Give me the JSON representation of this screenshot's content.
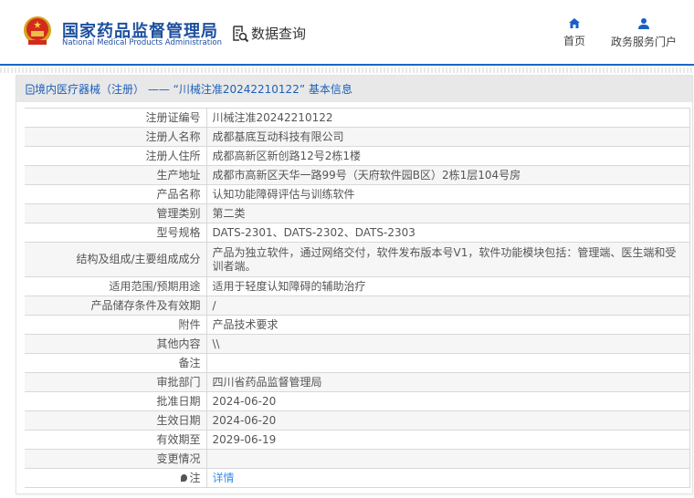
{
  "header": {
    "brand_cn": "国家药品监督管理局",
    "brand_en": "National Medical Products Administration",
    "data_query": "数据查询",
    "nav": [
      {
        "label": "首页",
        "icon": "home-icon"
      },
      {
        "label": "政务服务门户",
        "icon": "user-icon"
      }
    ]
  },
  "panel": {
    "title": "境内医疗器械（注册） —— “川械注准20242210122” 基本信息"
  },
  "rows": [
    {
      "label": "注册证编号",
      "value": "川械注准20242210122"
    },
    {
      "label": "注册人名称",
      "value": "成都基底互动科技有限公司"
    },
    {
      "label": "注册人住所",
      "value": "成都高新区新创路12号2栋1楼"
    },
    {
      "label": "生产地址",
      "value": "成都市高新区天华一路99号（天府软件园B区）2栋1层104号房"
    },
    {
      "label": "产品名称",
      "value": "认知功能障碍评估与训练软件"
    },
    {
      "label": "管理类别",
      "value": "第二类"
    },
    {
      "label": "型号规格",
      "value": "DATS-2301、DATS-2302、DATS-2303"
    },
    {
      "label": "结构及组成/主要组成成分",
      "value": "产品为独立软件，通过网络交付，软件发布版本号V1，软件功能模块包括：管理端、医生端和受训者端。"
    },
    {
      "label": "适用范围/预期用途",
      "value": "适用于轻度认知障碍的辅助治疗"
    },
    {
      "label": "产品储存条件及有效期",
      "value": "/"
    },
    {
      "label": "附件",
      "value": "产品技术要求"
    },
    {
      "label": "其他内容",
      "value": "\\\\"
    },
    {
      "label": "备注",
      "value": ""
    },
    {
      "label": "审批部门",
      "value": "四川省药品监督管理局"
    },
    {
      "label": "批准日期",
      "value": "2024-06-20"
    },
    {
      "label": "生效日期",
      "value": "2024-06-20"
    },
    {
      "label": "有效期至",
      "value": "2029-06-19"
    },
    {
      "label": "变更情况",
      "value": ""
    },
    {
      "label": "注",
      "value": "详情"
    }
  ]
}
